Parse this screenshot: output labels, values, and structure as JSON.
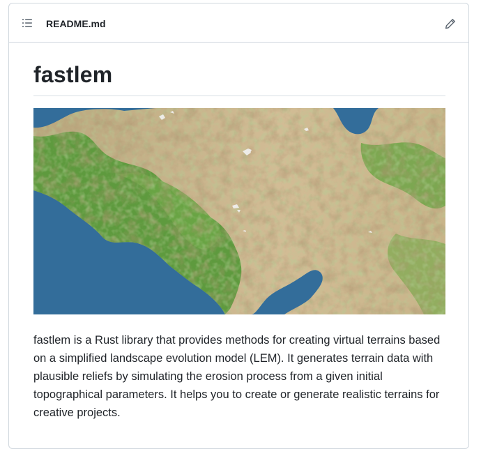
{
  "readme": {
    "file_name": "README.md",
    "toc_icon": "list-unordered-icon",
    "edit_icon": "pencil-icon"
  },
  "article": {
    "title": "fastlem",
    "image_alt": "fastlem terrain render",
    "description": "fastlem is a Rust library that provides methods for creating virtual terrains based on a simplified landscape evolution model (LEM). It generates terrain data with plausible reliefs by simulating the erosion process from a given initial topographical parameters. It helps you to create or generate realistic terrains for creative projects."
  },
  "colors": {
    "border": "#d0d7de",
    "text": "#1f2328",
    "icon": "#59636e",
    "sea": "#336d9a",
    "lowland": "#5e9a3e",
    "highland": "#c9b48e",
    "ridge": "#6b4a2a",
    "snow": "#f2f2f2"
  }
}
